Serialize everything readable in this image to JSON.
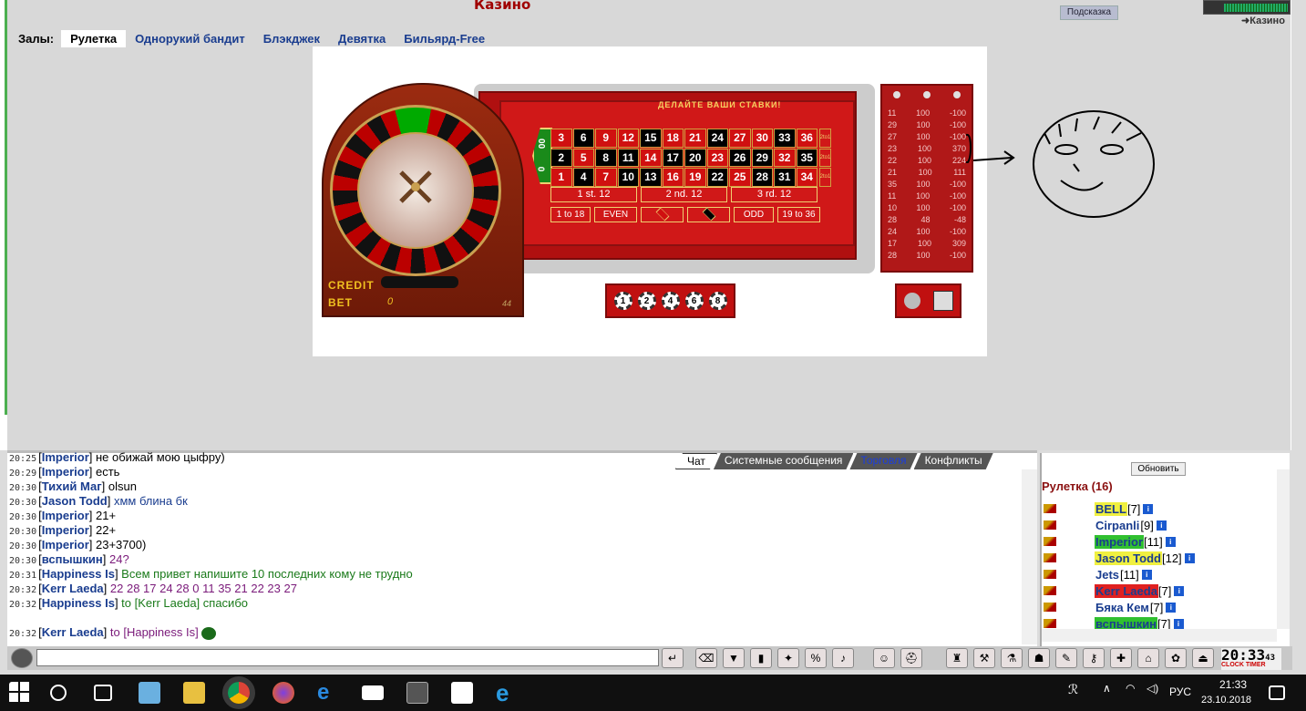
{
  "header": {
    "title": "Казино",
    "hint_button": "Подсказка",
    "casino_link": "Казино"
  },
  "halls": {
    "label": "Залы:",
    "tabs": [
      "Рулетка",
      "Однорукий бандит",
      "Блэкджек",
      "Девятка",
      "Бильярд-Free"
    ],
    "active": "Рулетка"
  },
  "game": {
    "bets_prompt": "ДЕЛАЙТЕ ВАШИ СТАВКИ!",
    "credit_label": "CREDIT",
    "bet_label": "BET",
    "bet_value": "0",
    "wheel_number": "44",
    "zero_labels": [
      "00",
      "0"
    ],
    "grid_rows": [
      [
        "3",
        "6",
        "9",
        "12",
        "15",
        "18",
        "21",
        "24",
        "27",
        "30",
        "33",
        "36"
      ],
      [
        "2",
        "5",
        "8",
        "11",
        "14",
        "17",
        "20",
        "23",
        "26",
        "29",
        "32",
        "35"
      ],
      [
        "1",
        "4",
        "7",
        "10",
        "13",
        "16",
        "19",
        "22",
        "25",
        "28",
        "31",
        "34"
      ]
    ],
    "column_bet": "2to1",
    "dozens": [
      "1 st. 12",
      "2 nd. 12",
      "3 rd. 12"
    ],
    "outside": [
      "1 to 18",
      "EVEN",
      "",
      "",
      "ODD",
      "19 to 36"
    ],
    "chips": [
      "1",
      "2",
      "4",
      "6",
      "8"
    ],
    "history": [
      [
        "11",
        "100",
        "-100"
      ],
      [
        "29",
        "100",
        "-100"
      ],
      [
        "27",
        "100",
        "-100"
      ],
      [
        "23",
        "100",
        "370"
      ],
      [
        "22",
        "100",
        "224"
      ],
      [
        "21",
        "100",
        "111"
      ],
      [
        "35",
        "100",
        "-100"
      ],
      [
        "11",
        "100",
        "-100"
      ],
      [
        "10",
        "100",
        "-100"
      ],
      [
        "28",
        "48",
        "-48"
      ],
      [
        "24",
        "100",
        "-100"
      ],
      [
        "17",
        "100",
        "309"
      ],
      [
        "28",
        "100",
        "-100"
      ]
    ]
  },
  "chat": {
    "tabs": [
      "Чат",
      "Системные сообщения",
      "Торговля",
      "Конфликты"
    ],
    "messages": [
      {
        "time": "20:25",
        "nick": "Imperior",
        "text": "не обижай мою цыфру)",
        "color": ""
      },
      {
        "time": "20:29",
        "nick": "Imperior",
        "text": "есть",
        "color": ""
      },
      {
        "time": "20:30",
        "nick": "Тихий Маг",
        "text": "olsun",
        "color": ""
      },
      {
        "time": "20:30",
        "nick": "Jason Todd",
        "text": "хмм блина бк",
        "color": "blue"
      },
      {
        "time": "20:30",
        "nick": "Imperior",
        "text": "21+",
        "color": ""
      },
      {
        "time": "20:30",
        "nick": "Imperior",
        "text": "22+",
        "color": ""
      },
      {
        "time": "20:30",
        "nick": "Imperior",
        "text": "23+3700)",
        "color": ""
      },
      {
        "time": "20:30",
        "nick": "вспышкин",
        "text": "24?",
        "color": "purple"
      },
      {
        "time": "20:31",
        "nick": "Happiness Is",
        "text": "Всем привет напишите 10 последних кому не трудно",
        "color": "green"
      },
      {
        "time": "20:32",
        "nick": "Kerr Laeda",
        "text": "22 28 17 24 28 0 11 35 21 22 23 27",
        "color": "purple"
      },
      {
        "time": "20:32",
        "nick": "Happiness Is",
        "text": "to [Kerr Laeda] спасибо",
        "color": "green"
      },
      {
        "time": "",
        "nick": "",
        "text": "",
        "color": ""
      },
      {
        "time": "20:32",
        "nick": "Kerr Laeda",
        "text": "to [Happiness Is]",
        "color": "purple"
      }
    ]
  },
  "users": {
    "refresh": "Обновить",
    "room": "Рулетка (16)",
    "list": [
      {
        "name": "BELL",
        "level": "[7]",
        "hl": "#f0f040"
      },
      {
        "name": "Cirpanli",
        "level": "[9]",
        "hl": ""
      },
      {
        "name": "Imperior",
        "level": "[11]",
        "hl": "#30c030"
      },
      {
        "name": "Jason Todd",
        "level": "[12]",
        "hl": "#f0f040"
      },
      {
        "name": "Jets",
        "level": "[11]",
        "hl": ""
      },
      {
        "name": "Kerr Laeda",
        "level": "[7]",
        "hl": "#e02020"
      },
      {
        "name": "Бяка Кем",
        "level": "[7]",
        "hl": ""
      },
      {
        "name": "вспышкин",
        "level": "[7]",
        "hl": "#30c030"
      }
    ]
  },
  "clock": {
    "time": "20:33",
    "seconds": "43",
    "labels": "CLOCK TIMER"
  },
  "taskbar": {
    "lang": "РУС",
    "time": "21:33",
    "date": "23.10.2018"
  }
}
